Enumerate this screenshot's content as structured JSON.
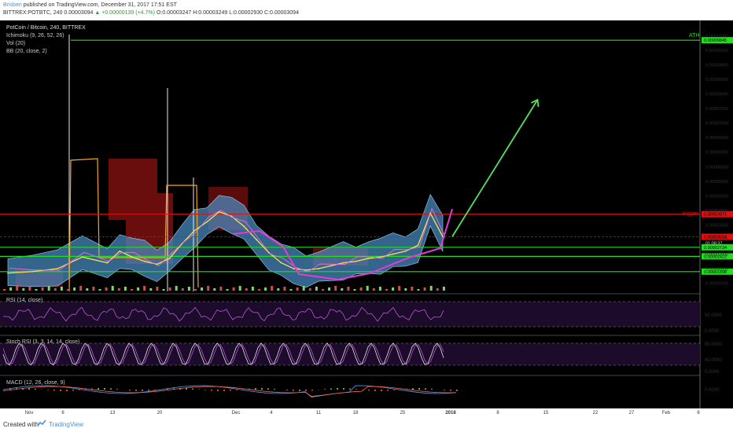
{
  "header": {
    "author": "Brisben",
    "published": "published on TradingView.com, December 31, 2017 17:51 EST",
    "symbol_line": "BITTREX:POTBTC, 240",
    "last": "0.00003094",
    "change": "+0.00000139 (+4.7%)",
    "open": "O:0.00003247",
    "high": "H:0.00003249",
    "low": "L:0.00002930",
    "close": "C:0.00003094"
  },
  "legend": {
    "title": "PotCoin / Bitcoin, 240, BITTREX",
    "ichimoku": "Ichimoku (9, 26, 52, 26)",
    "vol": "Vol (20)",
    "bb": "BB (20, close, 2)"
  },
  "labels": {
    "ath": "ATH",
    "trigger": "trigger",
    "rsi": "RSI (14, close)",
    "stoch": "Stoch RSI (3, 3, 14, 14, close)",
    "macd": "MACD (12, 26, close, 9)"
  },
  "footer": {
    "created": "Created with",
    "brand": "TradingView"
  },
  "colors": {
    "background": "#000000",
    "green_level": "#22dd22",
    "red_level": "#dd1111",
    "bb_fill": "#4a90c9",
    "cloud_red": "#7a1010",
    "price": "#f2e64a",
    "magenta": "#e53bd6",
    "arrow": "#55e05a"
  },
  "chart_data": {
    "type": "line",
    "title": "PotCoin / Bitcoin, 240, BITTREX",
    "x_ticks": [
      "Nov",
      "6",
      "13",
      "20",
      "Dec",
      "4",
      "11",
      "18",
      "25",
      "2018",
      "8",
      "15",
      "22",
      "27",
      "Feb",
      "6"
    ],
    "price_axis_ticks": [
      "0.00010000",
      "0.00009500",
      "0.00009000",
      "0.00008500",
      "0.00008000",
      "0.00007500",
      "0.00007000",
      "0.00006500",
      "0.00006000",
      "0.00005500",
      "0.00005000",
      "0.00004500",
      "0.00004000",
      "0.00003500",
      "0.00003000",
      "0.00002500",
      "0.00002000",
      "0.00001500"
    ],
    "ylim": [
      1.3e-05,
      0.000102
    ],
    "horizontal_levels": [
      {
        "name": "ATH",
        "value": 9.845e-05,
        "label": "0.00009845",
        "color": "#22dd22"
      },
      {
        "name": "trigger",
        "value": 3.871e-05,
        "label": "0.00003871",
        "color": "#dd1111"
      },
      {
        "name": "last",
        "value": 3.094e-05,
        "label": "0.00003094",
        "color": "#dd1111"
      },
      {
        "name": "support1",
        "value": 2.734e-05,
        "label": "0.00002734",
        "color": "#22dd22"
      },
      {
        "name": "support2",
        "value": 2.422e-05,
        "label": "0.00002422",
        "color": "#22dd22"
      },
      {
        "name": "support3",
        "value": 1.898e-05,
        "label": "0.00001898",
        "color": "#22dd22"
      }
    ],
    "countdown": "01:08:37",
    "series": [
      {
        "name": "price",
        "x": [
          0,
          4,
          8,
          12,
          16,
          18,
          20,
          22,
          24,
          26,
          28,
          30,
          32,
          34,
          36,
          38,
          40,
          42,
          44,
          46,
          48,
          50,
          52,
          54,
          56,
          58,
          60,
          62,
          64,
          66,
          68,
          70
        ],
        "values": [
          1.85e-05,
          1.9e-05,
          2e-05,
          2.4e-05,
          2.2e-05,
          2.6e-05,
          2.4e-05,
          2.25e-05,
          2.15e-05,
          2.35e-05,
          2.85e-05,
          3.3e-05,
          3.6e-05,
          3.95e-05,
          3.8e-05,
          3.45e-05,
          3e-05,
          2.55e-05,
          2.2e-05,
          2e-05,
          1.95e-05,
          2e-05,
          2.1e-05,
          2.2e-05,
          2.25e-05,
          2.35e-05,
          2.4e-05,
          2.5e-05,
          2.6e-05,
          2.8e-05,
          3.9e-05,
          3.1e-05
        ]
      }
    ],
    "projection": {
      "from": [
        70,
        3.1e-05
      ],
      "to": [
        85,
        7.8e-05
      ]
    },
    "rsi": {
      "ticks": [
        "50.0000",
        "0.0000"
      ]
    },
    "stoch_rsi": {
      "ticks": [
        "80.0000",
        "40.0000",
        "0.0000"
      ]
    },
    "macd": {
      "ticks": [
        "0.0000"
      ]
    }
  }
}
